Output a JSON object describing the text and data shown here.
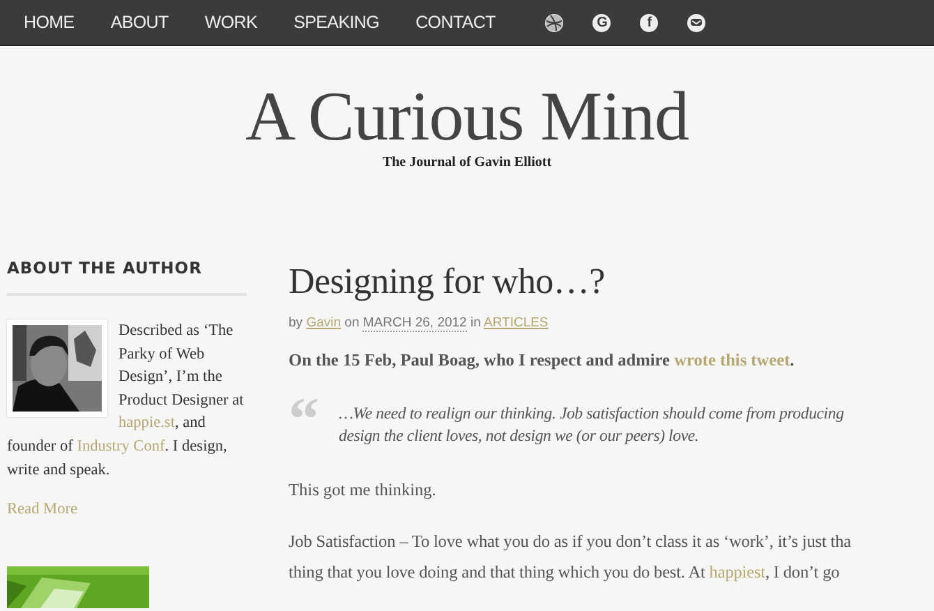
{
  "nav": {
    "items": [
      {
        "label": "HOME"
      },
      {
        "label": "ABOUT"
      },
      {
        "label": "WORK"
      },
      {
        "label": "SPEAKING"
      },
      {
        "label": "CONTACT"
      }
    ],
    "icons": [
      {
        "kind": "ball"
      },
      {
        "kind": "glyph",
        "glyph": "G"
      },
      {
        "kind": "glyph",
        "glyph": "f"
      },
      {
        "kind": "mail"
      }
    ]
  },
  "header": {
    "title": "A Curious Mind",
    "tagline": "The Journal of Gavin Elliott"
  },
  "sidebar": {
    "heading": "ABOUT THE AUTHOR",
    "bio": [
      {
        "text": "Described as ‘The Parky of Web Design’, I’m the Product Designer at "
      },
      {
        "text": "happie.st",
        "link": true
      },
      {
        "text": ", and"
      }
    ],
    "bio_rest": [
      {
        "text": "founder of "
      },
      {
        "text": "Industry Conf",
        "link": true
      },
      {
        "text": ". I design, write and speak."
      }
    ],
    "read_more": "Read More"
  },
  "post": {
    "title": "Designing for who…?",
    "meta": [
      {
        "text": "by "
      },
      {
        "text": "Gavin",
        "link": true
      },
      {
        "text": " on "
      },
      {
        "text": "MARCH 26, 2012",
        "date": true
      },
      {
        "text": " in "
      },
      {
        "text": "ARTICLES",
        "link": true
      }
    ],
    "intro": [
      {
        "text": "On the 15 Feb, Paul Boag, who I respect and admire "
      },
      {
        "text": "wrote this tweet",
        "link": true
      },
      {
        "text": "."
      }
    ],
    "quote_mark": "“",
    "quote_lines": [
      "…We need to realign our thinking. Job satisfaction should come from producing",
      "design the client loves, not design we (or our peers) love."
    ],
    "para": "This got me thinking.",
    "lines": [
      [
        {
          "text": "Job Satisfaction – To love what you do as if you don’t class it as ‘work’, it’s just tha"
        }
      ],
      [
        {
          "text": "thing that you love doing and that thing which you do best. At "
        },
        {
          "text": "happiest",
          "link": true
        },
        {
          "text": ", I don’t go"
        }
      ]
    ]
  }
}
